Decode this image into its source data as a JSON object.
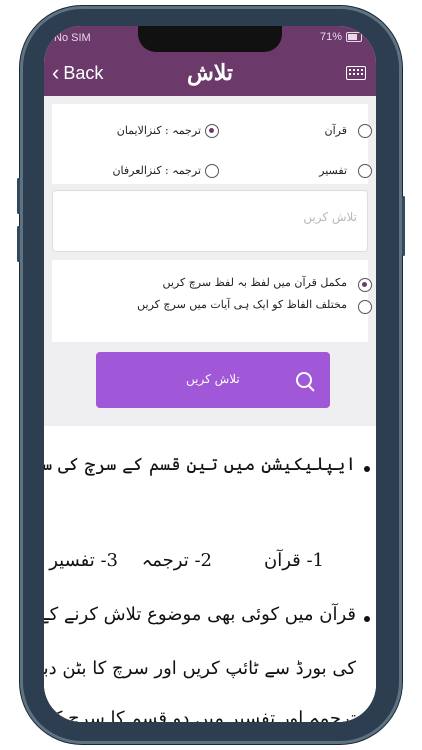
{
  "status": {
    "carrier": "No SIM",
    "battery": "71%"
  },
  "header": {
    "back_label": "Back",
    "title": "تلاش"
  },
  "scope_options": [
    {
      "label": "قرآن",
      "selected": false
    },
    {
      "label": "ترجمہ : کنزالایمان",
      "selected": true
    },
    {
      "label": "تفسیر",
      "selected": false
    },
    {
      "label": "ترجمہ : کنزالعرفان",
      "selected": false
    }
  ],
  "search": {
    "placeholder": "تلاش کریں",
    "value": ""
  },
  "match_options": [
    {
      "label": "مکمل قرآن میں لفظ بہ لفظ سرچ کریں",
      "selected": true
    },
    {
      "label": "مختلف الفاظ کو ایک ہی آیات میں سرچ کریں",
      "selected": false
    }
  ],
  "search_button": {
    "label": "تلاش کریں"
  },
  "info": {
    "line1": "ایپلیکیشن میں تین قسم کے سرچ کی سہولت موجود ہے۔",
    "types": [
      "1- قرآن",
      "2- ترجمہ",
      "3- تفسیر"
    ],
    "line2": "قرآن میں کوئی بھی موضوع تلاش کرنے کے لیے عربی",
    "line3": "کی بورڈ سے ٹائپ کریں اور سرچ کا بٹن دبائیں۔",
    "line4": "ترجمہ اور تفسیر میں دو قسم کا سرچ کرنے کی سہولت"
  },
  "colors": {
    "header": "#6b3a6b",
    "button": "#a057d8",
    "background": "#efeff2"
  }
}
